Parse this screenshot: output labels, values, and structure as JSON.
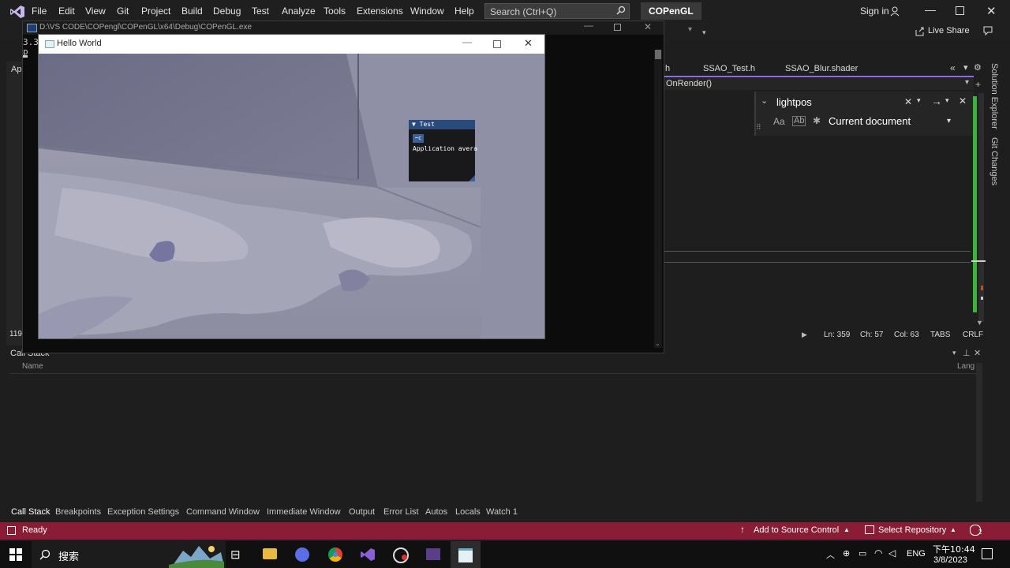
{
  "menubar": {
    "items": [
      "File",
      "Edit",
      "View",
      "Git",
      "Project",
      "Build",
      "Debug",
      "Test",
      "Analyze",
      "Tools",
      "Extensions",
      "Window",
      "Help"
    ],
    "search_placeholder": "Search (Ctrl+Q)",
    "solution_name": "COPenGL",
    "sign_in": "Sign in",
    "live_share": "Live Share"
  },
  "console": {
    "path": "D:\\VS CODE\\COPengl\\COPenGL\\x64\\Debug\\COPenGL.exe",
    "line1": "3.3",
    "line2": "p"
  },
  "hello_window": {
    "title": "Hello World",
    "imgui": {
      "title": "▼ Test",
      "button": "~c",
      "text": "Application avera"
    }
  },
  "editor": {
    "left_tab": "Ap",
    "tabs": [
      "h",
      "SSAO_Test.h",
      "SSAO_Blur.shader"
    ],
    "function_dropdown": "OnRender()",
    "left_line_hint": "119"
  },
  "find": {
    "query": "lightpos",
    "scope": "Current document",
    "opt_case": "Aa",
    "opt_word": "Ab"
  },
  "side_panels": {
    "solution_explorer": "Solution Explorer",
    "git_changes": "Git Changes"
  },
  "editor_status": {
    "line": "Ln: 359",
    "ch": "Ch: 57",
    "col": "Col: 63",
    "indent": "TABS",
    "eol": "CRLF"
  },
  "callstack": {
    "title": "Call Stack",
    "col_name": "Name",
    "col_lang": "Lang"
  },
  "bottom_tabs": [
    "Call Stack",
    "Breakpoints",
    "Exception Settings",
    "Command Window",
    "Immediate Window",
    "Output",
    "Error List",
    "Autos",
    "Locals",
    "Watch 1"
  ],
  "statusbar": {
    "ready": "Ready",
    "add_source": "Add to Source Control",
    "select_repo": "Select Repository",
    "notif_count": "2"
  },
  "taskbar": {
    "search_label": "搜索",
    "lang": "ENG",
    "time": "下午10:44",
    "date": "3/8/2023"
  },
  "colors": {
    "accent_status": "#8a1d35",
    "imgui_title": "#294a7a",
    "scroll_green": "#3cb43c"
  }
}
